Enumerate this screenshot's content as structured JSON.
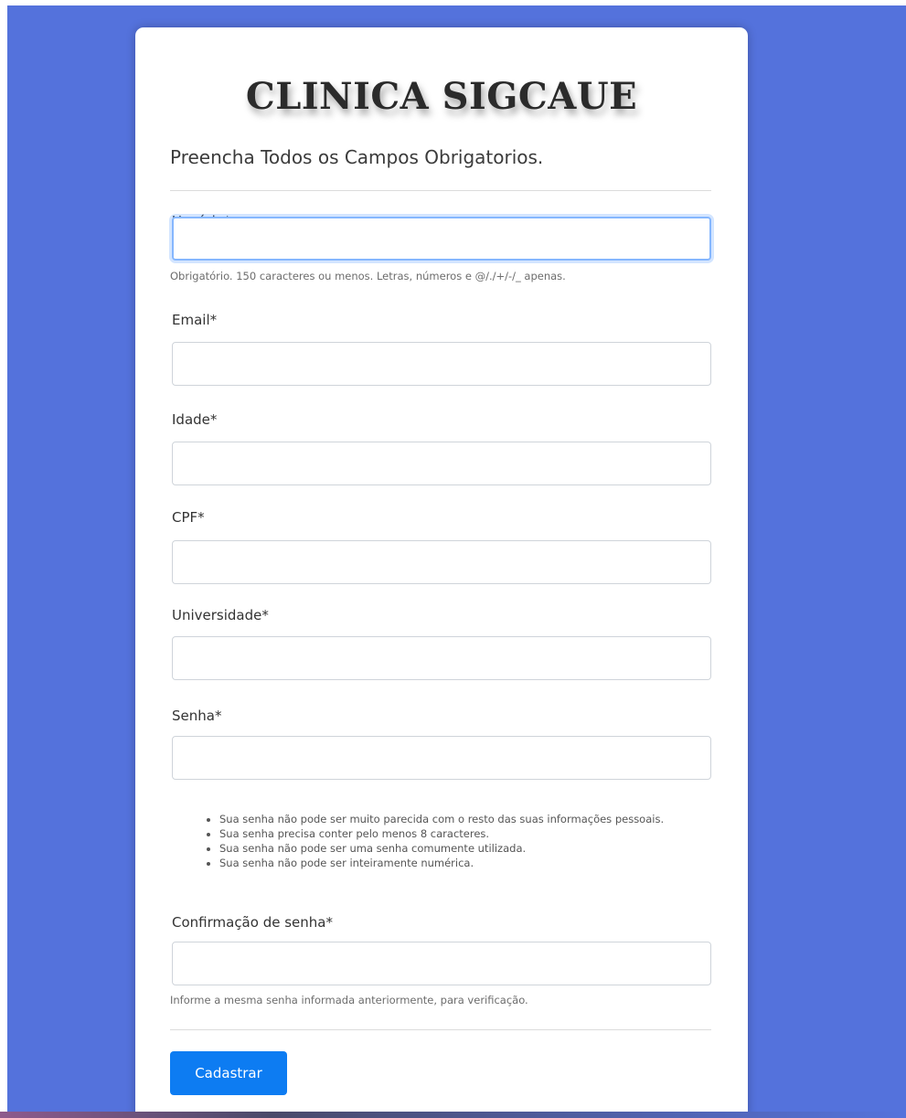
{
  "form": {
    "title": "CLINICA SIGCAUE",
    "subtitle": "Preencha Todos os Campos Obrigatorios.",
    "fields": {
      "usuario": {
        "label": "Usuário*",
        "value": "",
        "help": "Obrigatório. 150 caracteres ou menos. Letras, números e @/./+/-/_ apenas."
      },
      "email": {
        "label": "Email*",
        "value": ""
      },
      "idade": {
        "label": "Idade*",
        "value": ""
      },
      "cpf": {
        "label": "CPF*",
        "value": ""
      },
      "universidade": {
        "label": "Universidade*",
        "value": ""
      },
      "senha": {
        "label": "Senha*",
        "value": "",
        "rules": [
          "Sua senha não pode ser muito parecida com o resto das suas informações pessoais.",
          "Sua senha precisa conter pelo menos 8 caracteres.",
          "Sua senha não pode ser uma senha comumente utilizada.",
          "Sua senha não pode ser inteiramente numérica."
        ]
      },
      "confirmacao": {
        "label": "Confirmação de senha*",
        "value": "",
        "help": "Informe a mesma senha informada anteriormente, para verificação."
      }
    },
    "submit_label": "Cadastrar"
  },
  "colors": {
    "background": "#5472dc",
    "card": "#ffffff",
    "button": "#0d7cf2",
    "focus_border": "#86b7fe"
  }
}
